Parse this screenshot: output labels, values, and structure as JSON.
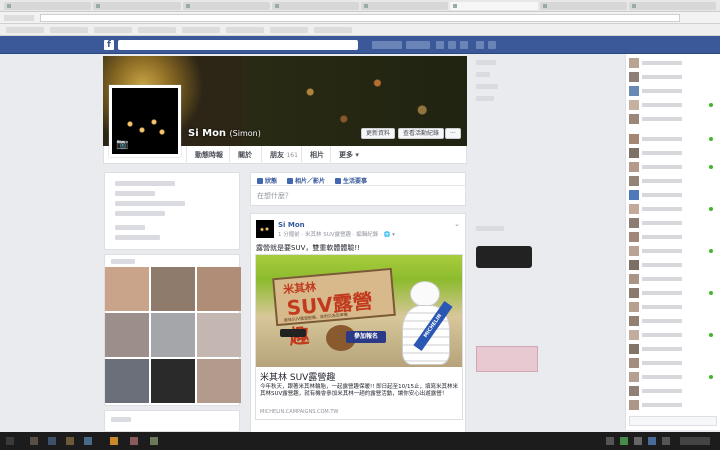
{
  "profile": {
    "name": "Si Mon",
    "alt_name": "(Simon)",
    "update_info": "更新資料",
    "activity_log": "查看活動紀錄",
    "more_dots": "···"
  },
  "tabs": [
    {
      "label": "動態時報"
    },
    {
      "label": "關於"
    },
    {
      "label": "朋友",
      "count": "161"
    },
    {
      "label": "相片"
    },
    {
      "label": "更多 ▾"
    }
  ],
  "composer": {
    "status": "狀態",
    "photo": "相片／影片",
    "life_event": "生活要事",
    "placeholder": "在想什麼？"
  },
  "post": {
    "author": "Si Mon",
    "meta": "1 分鐘前 · 米其林 SUV露營趣 · 編輯紀錄 · 🌐 ▾",
    "message": "露營就是要SUV，雙重軟體體驗!!",
    "banner": {
      "title1": "米其林",
      "title2": "SUV露營趣",
      "subtitle": "最佳SUV露營配備，我們只為您準備",
      "signup": "參加報名",
      "sash": "MICHELIN"
    },
    "link_title": "米其林 SUV露營趣",
    "link_desc": "今年秋天，跟著米其林輪胎，一起露營趣保暖!! 即日起至10/15止，填寫米其林米其林SUV露營趣，就有機會參加米其林一趟的露營活動，讓你安心出遊露營！",
    "link_source": "MICHELIN.CAMPAIGNS.COM.TW"
  },
  "colors": {
    "fb_blue": "#3b5998",
    "link_blue": "#365899",
    "online_green": "#42b72a"
  }
}
